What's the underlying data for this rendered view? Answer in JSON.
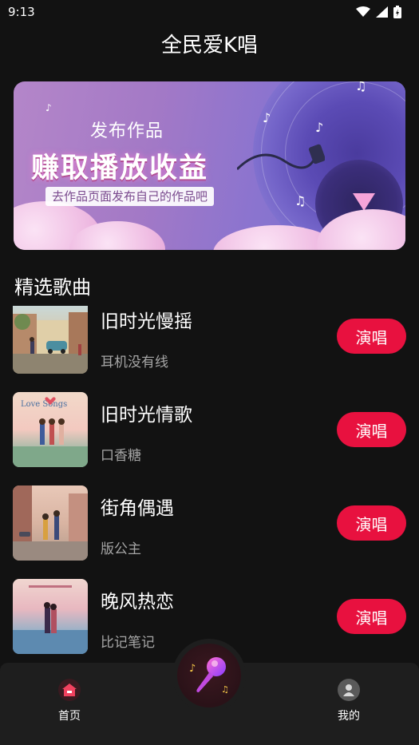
{
  "status_bar": {
    "time": "9:13"
  },
  "header": {
    "title": "全民爱K唱"
  },
  "banner": {
    "subtitle": "发布作品",
    "headline": "赚取播放收益",
    "tip": "去作品页面发布自己的作品吧"
  },
  "section": {
    "title": "精选歌曲"
  },
  "songs": [
    {
      "title": "旧时光慢摇",
      "artist": "耳机没有线",
      "button": "演唱"
    },
    {
      "title": "旧时光情歌",
      "artist": "口香糖",
      "button": "演唱"
    },
    {
      "title": "街角偶遇",
      "artist": "版公主",
      "button": "演唱"
    },
    {
      "title": "晚风热恋",
      "artist": "比记笔记",
      "button": "演唱"
    }
  ],
  "covers": {
    "cover2_text": "Love Songs"
  },
  "nav": {
    "home": "首页",
    "mine": "我的"
  },
  "colors": {
    "accent": "#e8113f",
    "background": "#121212",
    "nav_background": "#1e1e1e"
  }
}
